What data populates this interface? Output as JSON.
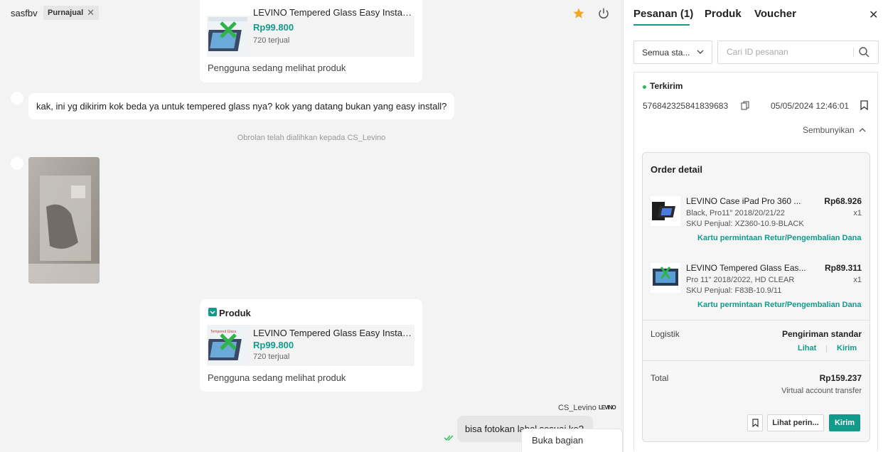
{
  "header": {
    "username": "sasfbv",
    "badge": "Purnajual",
    "colors": {
      "star": "#f5a623",
      "accent": "#129b8b"
    }
  },
  "chat": {
    "top_product": {
      "name": "LEVINO Tempered Glass Easy Install ...",
      "price": "Rp99.800",
      "sold": "720 terjual",
      "viewing_note": "Pengguna sedang melihat produk"
    },
    "customer_message": "kak, ini yg dikirim kok beda ya untuk tempered glass nya? kok yang datang bukan yang easy install?",
    "system_note": "Obrolan telah dialihkan kepada CS_Levino",
    "product_card": {
      "header": "Produk",
      "name": "LEVINO Tempered Glass Easy Install ...",
      "price": "Rp99.800",
      "sold": "720 terjual",
      "viewing_note": "Pengguna sedang melihat produk"
    },
    "agent": {
      "name": "CS_Levino",
      "message": "bisa fotokan label sesuai ke?"
    },
    "jump_bottom": "Buka bagian bawah"
  },
  "panel": {
    "tabs": [
      "Pesanan (1)",
      "Produk",
      "Voucher"
    ],
    "status_filter": "Semua sta...",
    "search_placeholder": "Cari ID pesanan",
    "order": {
      "status": "Terkirim",
      "id": "576842325841839683",
      "date": "05/05/2024 12:46:01",
      "hide_label": "Sembunyikan",
      "detail_title": "Order detail",
      "items": [
        {
          "name": "LEVINO Case iPad Pro 360 ...",
          "price": "Rp68.926",
          "variant": "Black, Pro11\" 2018/20/21/22",
          "qty": "x1",
          "sku": "SKU Penjual: XZ360-10.9-BLACK",
          "link": "Kartu permintaan Retur/Pengembalian Dana"
        },
        {
          "name": "LEVINO Tempered Glass Eas...",
          "price": "Rp89.311",
          "variant": "Pro 11\" 2018/2022, HD CLEAR",
          "qty": "x1",
          "sku": "SKU Penjual: F83B-10.9/11",
          "link": "Kartu permintaan Retur/Pengembalian Dana"
        }
      ],
      "logistics_label": "Logistik",
      "logistics_value": "Pengiriman standar",
      "logistics_links": [
        "Lihat",
        "Kirim"
      ],
      "total_label": "Total",
      "total_value": "Rp159.237",
      "payment_method": "Virtual account transfer",
      "actions": {
        "details": "Lihat perin...",
        "send": "Kirim"
      }
    }
  }
}
